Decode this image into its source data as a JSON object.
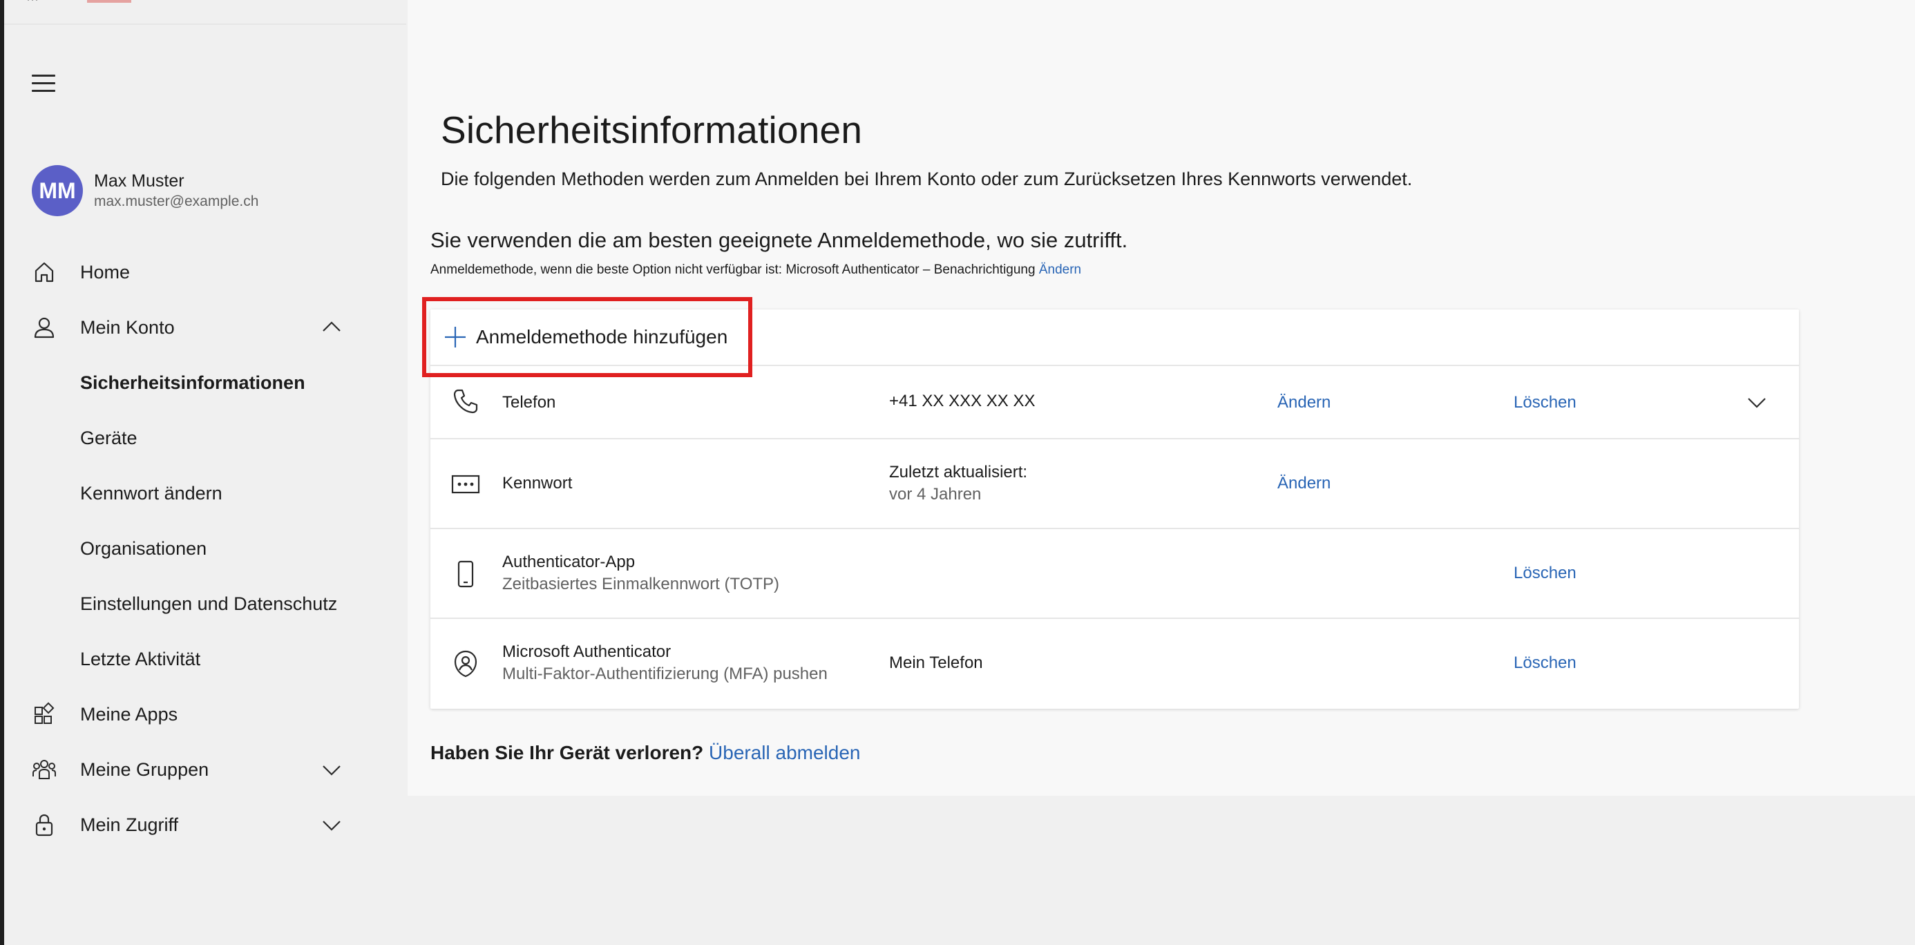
{
  "profile": {
    "initials": "MM",
    "name": "Max Muster",
    "email": "max.muster@example.ch"
  },
  "nav": {
    "home": "Home",
    "account": "Mein Konto",
    "security": "Sicherheitsinformationen",
    "devices": "Geräte",
    "password": "Kennwort ändern",
    "orgs": "Organisationen",
    "settings": "Einstellungen und Datenschutz",
    "activity": "Letzte Aktivität",
    "apps": "Meine Apps",
    "groups": "Meine Gruppen",
    "access": "Mein Zugriff"
  },
  "page": {
    "title": "Sicherheitsinformationen",
    "description": "Die folgenden Methoden werden zum Anmelden bei Ihrem Konto oder zum Zurücksetzen Ihres Kennworts verwendet.",
    "default_heading": "Sie verwenden die am besten geeignete Anmeldemethode, wo sie zutrifft.",
    "default_line": "Anmeldemethode, wenn die beste Option nicht verfügbar ist: Microsoft Authenticator – Benachrichtigung",
    "default_change": "Ändern",
    "add_method": "Anmeldemethode hinzufügen"
  },
  "methods": [
    {
      "title": "Telefon",
      "detail": "+41 XX XXX XX XX",
      "change": "Ändern",
      "delete": "Löschen"
    },
    {
      "title": "Kennwort",
      "detail": "Zuletzt aktualisiert:",
      "detail2": "vor 4 Jahren",
      "change": "Ändern"
    },
    {
      "title": "Authenticator-App",
      "subtitle": "Zeitbasiertes Einmalkennwort (TOTP)",
      "delete": "Löschen"
    },
    {
      "title": "Microsoft Authenticator",
      "subtitle": "Multi-Faktor-Authentifizierung (MFA) pushen",
      "detail": "Mein Telefon",
      "delete": "Löschen"
    }
  ],
  "lost": {
    "question": "Haben Sie Ihr Gerät verloren?",
    "link": "Überall abmelden"
  },
  "colors": {
    "accent": "#2965b5",
    "avatar": "#5b5fc7",
    "highlight": "#e02020"
  }
}
